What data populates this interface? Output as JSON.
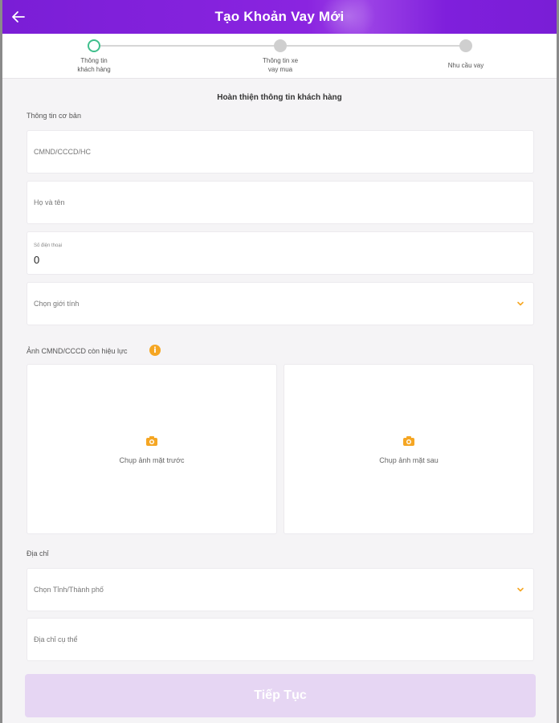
{
  "header": {
    "title": "Tạo Khoản Vay Mới"
  },
  "stepper": {
    "steps": [
      {
        "label": "Thông tin\nkhách hàng",
        "state": "active"
      },
      {
        "label": "Thông tin xe\nvay mua",
        "state": "inactive"
      },
      {
        "label": "Nhu cầu vay",
        "state": "inactive"
      }
    ]
  },
  "form": {
    "heading": "Hoàn thiện thông tin khách hàng",
    "basic_info_label": "Thông tin cơ bản",
    "id_number": {
      "placeholder": "CMND/CCCD/HC",
      "value": ""
    },
    "full_name": {
      "placeholder": "Họ và tên",
      "value": ""
    },
    "phone": {
      "label": "Số điện thoại",
      "value": "0"
    },
    "gender": {
      "placeholder": "Chọn giới tính"
    },
    "id_photos_label": "Ảnh CMND/CCCD còn hiệu lực",
    "info_icon": "i",
    "front_photo": {
      "label": "Chụp ảnh mặt trước",
      "icon": "camera-icon"
    },
    "back_photo": {
      "label": "Chụp ảnh mặt sau",
      "icon": "camera-icon"
    },
    "address_label": "Địa chỉ",
    "province": {
      "placeholder": "Chọn Tỉnh/Thành phố"
    },
    "address_detail": {
      "placeholder": "Địa chỉ cụ thể"
    }
  },
  "footer": {
    "continue_label": "Tiếp Tục"
  },
  "colors": {
    "brand_purple": "#7a1ed6",
    "active_step": "#3fbf8c",
    "accent_orange": "#f5a623",
    "button_disabled": "#e6d6f3"
  }
}
